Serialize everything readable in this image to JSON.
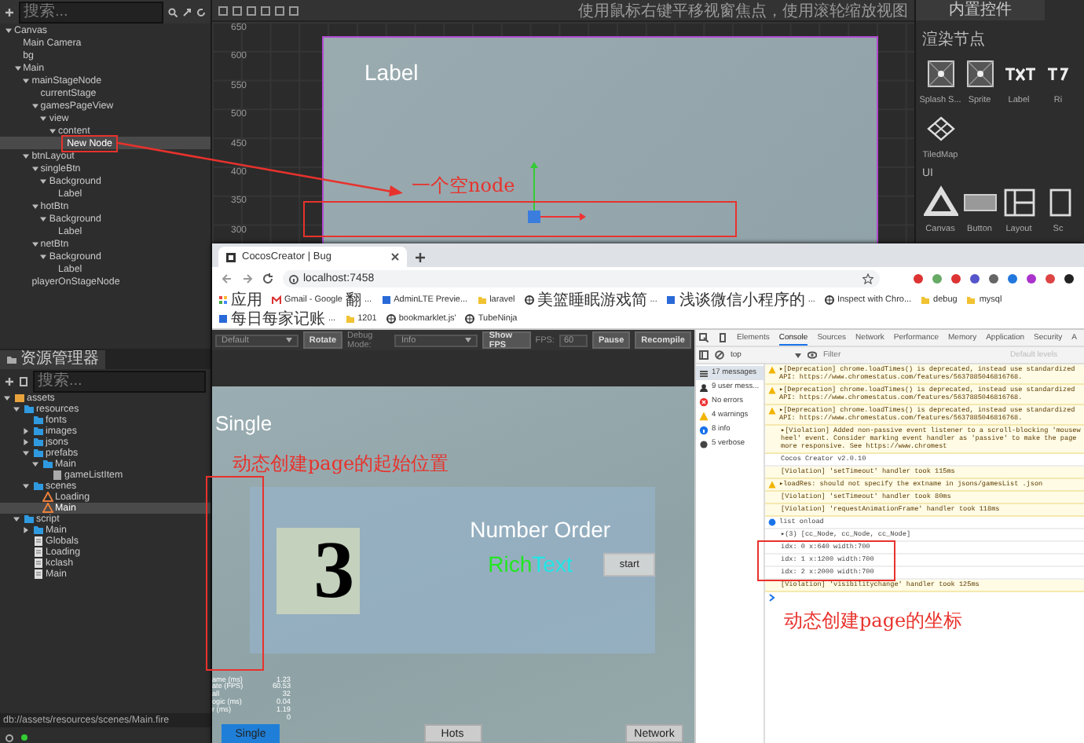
{
  "hierarchy": {
    "search_placeholder": "搜索...",
    "nodes": [
      {
        "name": "Canvas",
        "expanded": true,
        "selected": false,
        "children": [
          {
            "name": "Main Camera",
            "selected": false
          },
          {
            "name": "bg",
            "selected": false
          },
          {
            "name": "Main",
            "expanded": true,
            "selected": false,
            "children": [
              {
                "name": "mainStageNode",
                "expanded": true,
                "selected": false,
                "children": [
                  {
                    "name": "currentStage",
                    "selected": false
                  },
                  {
                    "name": "gamesPageView",
                    "expanded": true,
                    "selected": false,
                    "children": [
                      {
                        "name": "view",
                        "expanded": true,
                        "selected": false,
                        "children": [
                          {
                            "name": "content",
                            "expanded": true,
                            "selected": false,
                            "children": [
                              {
                                "name": "New Node",
                                "selected": true
                              }
                            ]
                          }
                        ]
                      }
                    ]
                  }
                ]
              },
              {
                "name": "btnLayout",
                "expanded": true,
                "selected": false,
                "children": [
                  {
                    "name": "singleBtn",
                    "expanded": true,
                    "selected": false,
                    "children": [
                      {
                        "name": "Background",
                        "expanded": true,
                        "selected": false,
                        "children": [
                          {
                            "name": "Label",
                            "selected": false
                          }
                        ]
                      }
                    ]
                  },
                  {
                    "name": "hotBtn",
                    "expanded": true,
                    "selected": false,
                    "children": [
                      {
                        "name": "Background",
                        "expanded": true,
                        "selected": false,
                        "children": [
                          {
                            "name": "Label",
                            "selected": false
                          }
                        ]
                      }
                    ]
                  },
                  {
                    "name": "netBtn",
                    "expanded": true,
                    "selected": false,
                    "children": [
                      {
                        "name": "Background",
                        "expanded": true,
                        "selected": false,
                        "children": [
                          {
                            "name": "Label",
                            "selected": false
                          }
                        ]
                      }
                    ]
                  }
                ]
              },
              {
                "name": "playerOnStageNode",
                "selected": false
              }
            ]
          }
        ]
      }
    ]
  },
  "scene": {
    "hint": "使用鼠标右键平移视窗焦点，使用滚轮缩放视图",
    "y_ticks": [
      "650",
      "600",
      "550",
      "500",
      "450",
      "400",
      "350",
      "300"
    ],
    "label": "Label"
  },
  "widgets": {
    "tab": "内置控件",
    "sections": [
      {
        "title": "渲染节点",
        "items": [
          {
            "label": "Splash S...",
            "kind": "splash"
          },
          {
            "label": "Sprite",
            "kind": "sprite"
          },
          {
            "label": "Label",
            "kind": "label"
          },
          {
            "label": "Ri",
            "kind": "richtext"
          },
          {
            "label": "TiledMap",
            "kind": "tiledmap"
          }
        ]
      },
      {
        "title": "UI",
        "items": [
          {
            "label": "Canvas",
            "kind": "canvas"
          },
          {
            "label": "Button",
            "kind": "button"
          },
          {
            "label": "Layout",
            "kind": "layout"
          },
          {
            "label": "Sc",
            "kind": "scroll"
          }
        ]
      }
    ]
  },
  "assets": {
    "tab": "资源管理器",
    "search_placeholder": "搜索...",
    "tree": [
      {
        "name": "assets",
        "kind": "root",
        "expanded": true,
        "selected": false,
        "children": [
          {
            "name": "resources",
            "kind": "folder",
            "expanded": true,
            "selected": false,
            "children": [
              {
                "name": "fonts",
                "kind": "folder",
                "selected": false
              },
              {
                "name": "images",
                "kind": "folder",
                "expanded": false,
                "selected": false
              },
              {
                "name": "jsons",
                "kind": "folder",
                "expanded": false,
                "selected": false
              },
              {
                "name": "prefabs",
                "kind": "folder",
                "expanded": true,
                "selected": false,
                "children": [
                  {
                    "name": "Main",
                    "kind": "folder",
                    "expanded": true,
                    "selected": false,
                    "children": [
                      {
                        "name": "gameListItem",
                        "kind": "prefab",
                        "selected": false
                      }
                    ]
                  }
                ]
              },
              {
                "name": "scenes",
                "kind": "folder",
                "expanded": true,
                "selected": false,
                "children": [
                  {
                    "name": "Loading",
                    "kind": "scene",
                    "selected": false
                  },
                  {
                    "name": "Main",
                    "kind": "scene",
                    "selected": true
                  }
                ]
              }
            ]
          },
          {
            "name": "script",
            "kind": "folder",
            "expanded": true,
            "selected": false,
            "children": [
              {
                "name": "Main",
                "kind": "folder",
                "expanded": false,
                "selected": false
              },
              {
                "name": "Globals",
                "kind": "script",
                "selected": false
              },
              {
                "name": "Loading",
                "kind": "script",
                "selected": false
              },
              {
                "name": "kclash",
                "kind": "script",
                "selected": false
              },
              {
                "name": "Main",
                "kind": "script",
                "selected": false
              }
            ]
          }
        ]
      }
    ],
    "path": "db://assets/resources/scenes/Main.fire"
  },
  "browser": {
    "tab_title": "CocosCreator | Bug",
    "url": "localhost:7458",
    "bookmarks": [
      {
        "label": "应用",
        "kind": "apps"
      },
      {
        "label": "Gmail - Google 翻...",
        "kind": "gmail"
      },
      {
        "label": "AdminLTE Previe...",
        "kind": "site"
      },
      {
        "label": "laravel",
        "kind": "folder"
      },
      {
        "label": "美篮睡眠游戏简...",
        "kind": "globe"
      },
      {
        "label": "浅谈微信小程序的...",
        "kind": "site"
      },
      {
        "label": "Inspect with Chro...",
        "kind": "globe"
      },
      {
        "label": "debug",
        "kind": "folder"
      },
      {
        "label": "mysql",
        "kind": "folder"
      },
      {
        "label": "每日每家记账...",
        "kind": "site"
      },
      {
        "label": "1201",
        "kind": "folder"
      },
      {
        "label": "bookmarklet.js'",
        "kind": "globe"
      },
      {
        "label": "TubeNinja",
        "kind": "globe"
      }
    ]
  },
  "game": {
    "toolbar": [
      {
        "kind": "dropdown",
        "label": "Default"
      },
      {
        "kind": "button",
        "label": "Rotate"
      },
      {
        "kind": "text",
        "label": "Debug Mode:"
      },
      {
        "kind": "dropdown",
        "label": "Info"
      },
      {
        "kind": "button",
        "label": "Show FPS"
      },
      {
        "kind": "text",
        "label": "FPS:"
      },
      {
        "kind": "input",
        "label": "60"
      },
      {
        "kind": "button",
        "label": "Pause"
      },
      {
        "kind": "button",
        "label": "Recompile"
      }
    ],
    "title": "Single",
    "card_title": "Number Order",
    "card_number": "3",
    "rich_text": [
      {
        "text": "Rich",
        "color": "#22e622"
      },
      {
        "text": "Text",
        "color": "#22e6e6"
      }
    ],
    "start": "start",
    "stats": [
      {
        "label": "ame (ms)",
        "value": "1.23"
      },
      {
        "label": "ate (FPS)",
        "value": "60.53"
      },
      {
        "label": "all",
        "value": "32"
      },
      {
        "label": "ogic (ms)",
        "value": "0.04"
      },
      {
        "label": "r (ms)",
        "value": "1.19"
      },
      {
        "value": "0"
      }
    ],
    "nav": [
      {
        "label": "Single",
        "selected": true
      },
      {
        "label": "Hots",
        "selected": false
      },
      {
        "label": "Network",
        "selected": false
      }
    ]
  },
  "devtools": {
    "tabs": [
      {
        "label": "Elements",
        "selected": false
      },
      {
        "label": "Console",
        "selected": true
      },
      {
        "label": "Sources",
        "selected": false
      },
      {
        "label": "Network",
        "selected": false
      },
      {
        "label": "Performance",
        "selected": false
      },
      {
        "label": "Memory",
        "selected": false
      },
      {
        "label": "Application",
        "selected": false
      },
      {
        "label": "Security",
        "selected": false
      },
      {
        "label": "A",
        "selected": false
      }
    ],
    "context": "top",
    "filter_placeholder": "Filter",
    "levels": "Default levels",
    "sidebar": [
      {
        "label": "17 messages",
        "kind": "all",
        "selected": true
      },
      {
        "label": "9 user mess...",
        "kind": "user",
        "selected": false
      },
      {
        "label": "No errors",
        "kind": "error",
        "selected": false
      },
      {
        "label": "4 warnings",
        "kind": "warning",
        "selected": false
      },
      {
        "label": "8 info",
        "kind": "info",
        "selected": false
      },
      {
        "label": "5 verbose",
        "kind": "verbose",
        "selected": false
      }
    ],
    "messages": [
      {
        "kind": "warning",
        "text": "▸[Deprecation] chrome.loadTimes() is deprecated, instead use standardized API: https://www.chromestatus.com/features/5637885046816768."
      },
      {
        "kind": "warning",
        "text": "▸[Deprecation] chrome.loadTimes() is deprecated, instead use standardized API: https://www.chromestatus.com/features/5637885046816768."
      },
      {
        "kind": "warning",
        "text": "▸[Deprecation] chrome.loadTimes() is deprecated, instead use standardized API: https://www.chromestatus.com/features/5637885046816768."
      },
      {
        "kind": "violation",
        "text": "▸[Violation] Added non-passive event listener to a scroll-blocking 'mousewheel' event. Consider marking event handler as 'passive' to make the page more responsive. See https://www.chromest"
      },
      {
        "kind": "log",
        "text": "Cocos Creator v2.0.10"
      },
      {
        "kind": "violation",
        "text": "[Violation] 'setTimeout' handler took 115ms"
      },
      {
        "kind": "warning",
        "text": "▸loadRes: should not specify the extname in jsons/gamesList .json"
      },
      {
        "kind": "violation",
        "text": "[Violation] 'setTimeout' handler took 80ms"
      },
      {
        "kind": "violation",
        "text": "[Violation] 'requestAnimationFrame' handler took 118ms"
      },
      {
        "kind": "info",
        "text": "list onload"
      },
      {
        "kind": "log",
        "text": "▸(3) [cc_Node, cc_Node, cc_Node]"
      },
      {
        "kind": "log",
        "text": "idx: 0 x:640 width:700"
      },
      {
        "kind": "log",
        "text": "idx: 1 x:1200 width:700"
      },
      {
        "kind": "log",
        "text": "idx: 2 x:2000 width:700"
      },
      {
        "kind": "violation",
        "text": "[Violation] 'visibilitychange' handler took 125ms"
      }
    ]
  },
  "annotations": [
    {
      "text": "一个空node"
    },
    {
      "text": "动态创建page的起始位置"
    },
    {
      "text": "动态创建page的坐标"
    }
  ]
}
